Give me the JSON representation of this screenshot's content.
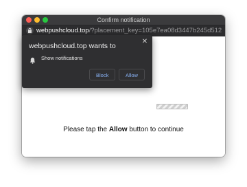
{
  "window": {
    "title": "Confirm notification"
  },
  "urlbar": {
    "host": "webpushcloud.top",
    "path": "/?placement_key=105e7ea08d3447b245d512a..."
  },
  "popup": {
    "title": "webpushcloud.top wants to",
    "permission": "Show notifications",
    "close_icon": "close-icon",
    "block_label": "Block",
    "allow_label": "Allow"
  },
  "page": {
    "instruction_before": "Please tap the ",
    "instruction_bold": "Allow",
    "instruction_after": " button to continue"
  },
  "colors": {
    "accent": "#8ab4f8",
    "popup_bg": "#2f2f31",
    "titlebar_bg": "#3b3b3d"
  }
}
